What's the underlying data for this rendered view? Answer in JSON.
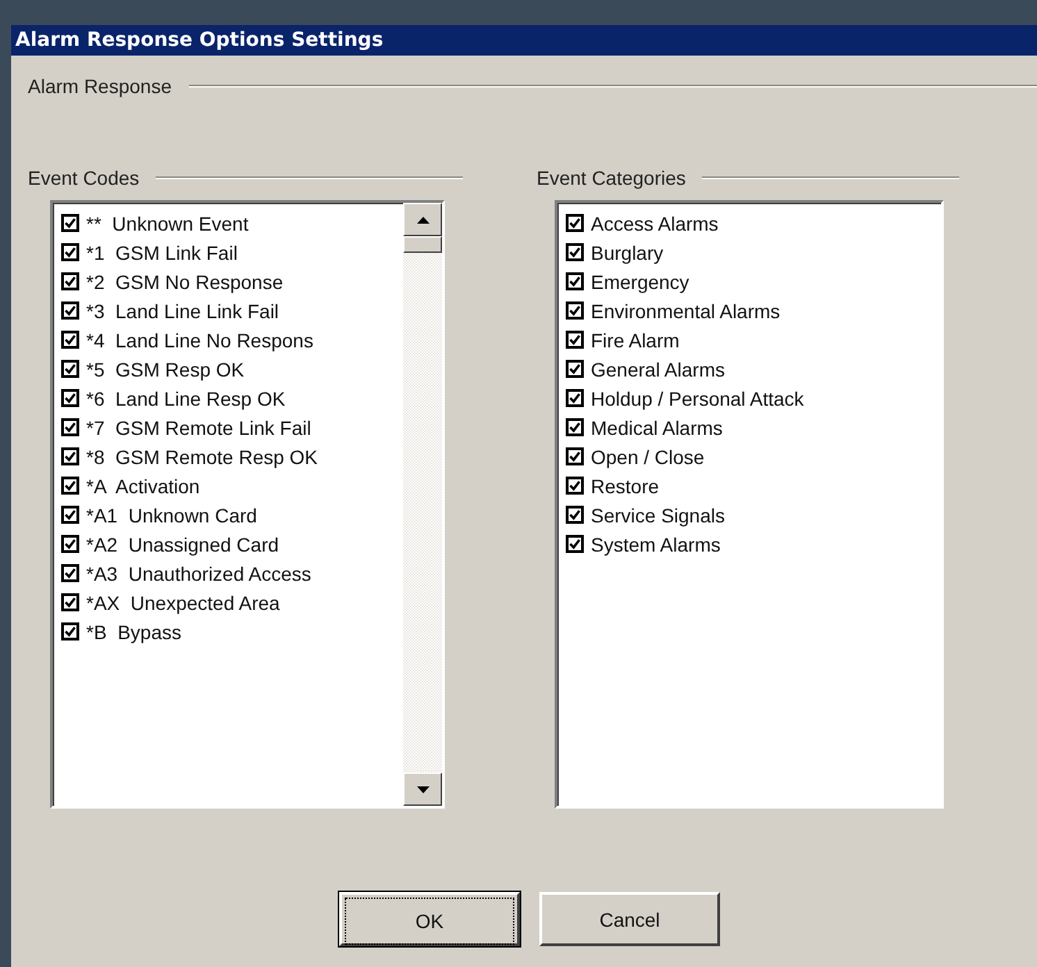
{
  "window": {
    "title": "Alarm Response Options Settings"
  },
  "group": {
    "label": "Alarm Response"
  },
  "event_codes": {
    "label": "Event Codes",
    "items": [
      {
        "label": "**  Unknown Event",
        "checked": true
      },
      {
        "label": "*1  GSM Link Fail",
        "checked": true
      },
      {
        "label": "*2  GSM No Response",
        "checked": true
      },
      {
        "label": "*3  Land Line Link Fail",
        "checked": true
      },
      {
        "label": "*4  Land Line No Respons",
        "checked": true
      },
      {
        "label": "*5  GSM Resp OK",
        "checked": true
      },
      {
        "label": "*6  Land Line Resp OK",
        "checked": true
      },
      {
        "label": "*7  GSM Remote Link Fail",
        "checked": true
      },
      {
        "label": "*8  GSM Remote Resp OK",
        "checked": true
      },
      {
        "label": "*A  Activation",
        "checked": true
      },
      {
        "label": "*A1  Unknown Card",
        "checked": true
      },
      {
        "label": "*A2  Unassigned Card",
        "checked": true
      },
      {
        "label": "*A3  Unauthorized Access",
        "checked": true
      },
      {
        "label": "*AX  Unexpected Area",
        "checked": true
      },
      {
        "label": "*B  Bypass",
        "checked": true
      }
    ]
  },
  "event_categories": {
    "label": "Event Categories",
    "items": [
      {
        "label": "Access Alarms",
        "checked": true
      },
      {
        "label": "Burglary",
        "checked": true
      },
      {
        "label": "Emergency",
        "checked": true
      },
      {
        "label": "Environmental Alarms",
        "checked": true
      },
      {
        "label": "Fire Alarm",
        "checked": true
      },
      {
        "label": "General Alarms",
        "checked": true
      },
      {
        "label": "Holdup / Personal Attack",
        "checked": true
      },
      {
        "label": "Medical Alarms",
        "checked": true
      },
      {
        "label": "Open / Close",
        "checked": true
      },
      {
        "label": "Restore",
        "checked": true
      },
      {
        "label": "Service Signals",
        "checked": true
      },
      {
        "label": "System Alarms",
        "checked": true
      }
    ]
  },
  "buttons": [
    {
      "label": "OK",
      "default": true
    },
    {
      "label": "Cancel",
      "default": false
    }
  ]
}
